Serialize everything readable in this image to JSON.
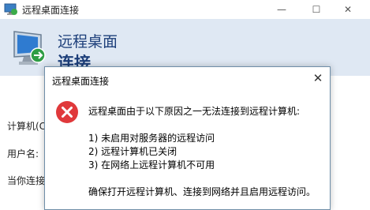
{
  "window": {
    "title": "远程桌面连接",
    "controls": {
      "minimize": "—",
      "maximize": "☐",
      "close": "✕"
    }
  },
  "banner": {
    "line1": "远程桌面",
    "line2": "连接"
  },
  "main": {
    "computer_label": "计算机(C",
    "user_label": "用户名:",
    "hint": "当你连接"
  },
  "dialog": {
    "title": "远程桌面连接",
    "close": "✕",
    "icon": "error-icon",
    "message": "远程桌面由于以下原因之一无法连接到远程计算机:",
    "reasons": [
      "1) 未启用对服务器的远程访问",
      "2) 远程计算机已关闭",
      "3) 在网络上远程计算机不可用"
    ],
    "footer": "确保打开远程计算机、连接到网络并且启用远程访问。"
  },
  "colors": {
    "banner_bg": "#dfe8f3",
    "banner_text": "#1d3f7a",
    "error_red": "#e0393b",
    "dialog_border": "#6f8ea8"
  }
}
